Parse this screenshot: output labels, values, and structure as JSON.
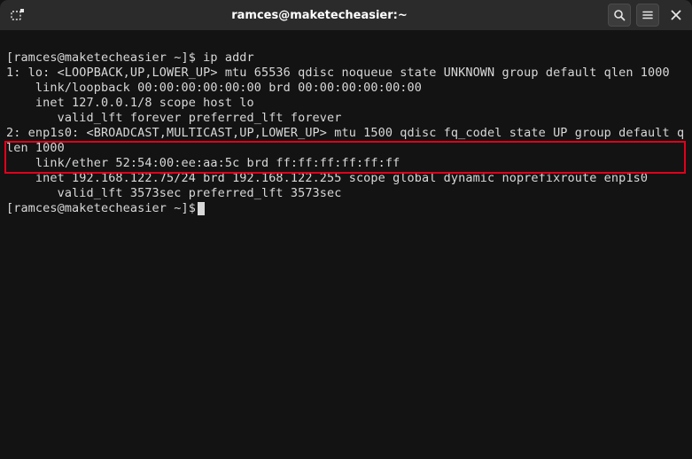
{
  "titlebar": {
    "title": "ramces@maketecheasier:~"
  },
  "terminal": {
    "prompt_user": "ramces",
    "prompt_symbol": "$",
    "command": "ip addr",
    "prompt_host": "maketecheasier",
    "prompt1": "[ramces@maketecheasier ~]$ ",
    "prompt2": "[ramces@maketecheasier ~]$",
    "out": {
      "l1": "1: lo: <LOOPBACK,UP,LOWER_UP> mtu 65536 qdisc noqueue state UNKNOWN group default qlen 1000",
      "l2": "    link/loopback 00:00:00:00:00:00 brd 00:00:00:00:00:00",
      "l3": "    inet 127.0.0.1/8 scope host lo",
      "l4": "       valid_lft forever preferred_lft forever",
      "l5": "2: enp1s0: <BROADCAST,MULTICAST,UP,LOWER_UP> mtu 1500 qdisc fq_codel state UP group default qlen 1000",
      "l6": "    link/ether 52:54:00:ee:aa:5c brd ff:ff:ff:ff:ff:ff",
      "l7": "    inet 192.168.122.75/24 brd 192.168.122.255 scope global dynamic noprefixroute enp1s0",
      "l8": "       valid_lft 3573sec preferred_lft 3573sec"
    }
  }
}
